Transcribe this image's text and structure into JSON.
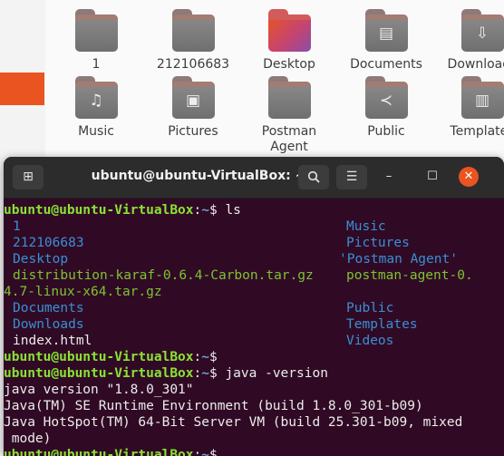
{
  "files": {
    "items": [
      {
        "label": "1",
        "icon": "folder-icon"
      },
      {
        "label": "212106683",
        "icon": "folder-icon"
      },
      {
        "label": "Desktop",
        "icon": "desktop-folder-icon"
      },
      {
        "label": "Documents",
        "icon": "documents-folder-icon"
      },
      {
        "label": "Downloads",
        "icon": "downloads-folder-icon"
      },
      {
        "label": "Music",
        "icon": "music-folder-icon"
      },
      {
        "label": "Pictures",
        "icon": "pictures-folder-icon"
      },
      {
        "label": "Postman Agent",
        "icon": "folder-icon"
      },
      {
        "label": "Public",
        "icon": "public-folder-icon"
      },
      {
        "label": "Templates",
        "icon": "templates-folder-icon"
      }
    ],
    "sidebar_accent": "#e95420"
  },
  "terminal": {
    "title": "ubuntu@ubuntu-VirtualBox: ~",
    "new_tab_icon": "new-tab-icon",
    "search_icon": "search-icon",
    "menu_icon": "hamburger-menu-icon",
    "minimize_icon": "minimize-icon",
    "maximize_icon": "maximize-icon",
    "close_icon": "close-icon",
    "prompt_user": "ubuntu@ubuntu-VirtualBox",
    "prompt_sep": ":",
    "prompt_path": "~",
    "prompt_sign": "$",
    "cmd_ls": " ls",
    "cmd_java": " java -version",
    "ls_col1": [
      "1",
      "212106683",
      "Desktop",
      "distribution-karaf-0.6.4-Carbon.tar.gz",
      "4.7-linux-x64.tar.gz",
      "Documents",
      "Downloads",
      "index.html"
    ],
    "ls_col2": [
      "Music",
      "Pictures",
      "'Postman Agent'",
      "postman-agent-0.",
      "",
      "Public",
      "Templates",
      "Videos"
    ],
    "java_out": [
      "java version \"1.8.0_301\"",
      "Java(TM) SE Runtime Environment (build 1.8.0_301-b09)",
      "Java HotSpot(TM) 64-Bit Server VM (build 25.301-b09, mixed",
      " mode)"
    ],
    "colors": {
      "background": "#300a24",
      "prompt_user": "#8ae234",
      "prompt_path": "#729fcf",
      "directory": "#3b8fd6",
      "archive": "#7ec332"
    }
  }
}
